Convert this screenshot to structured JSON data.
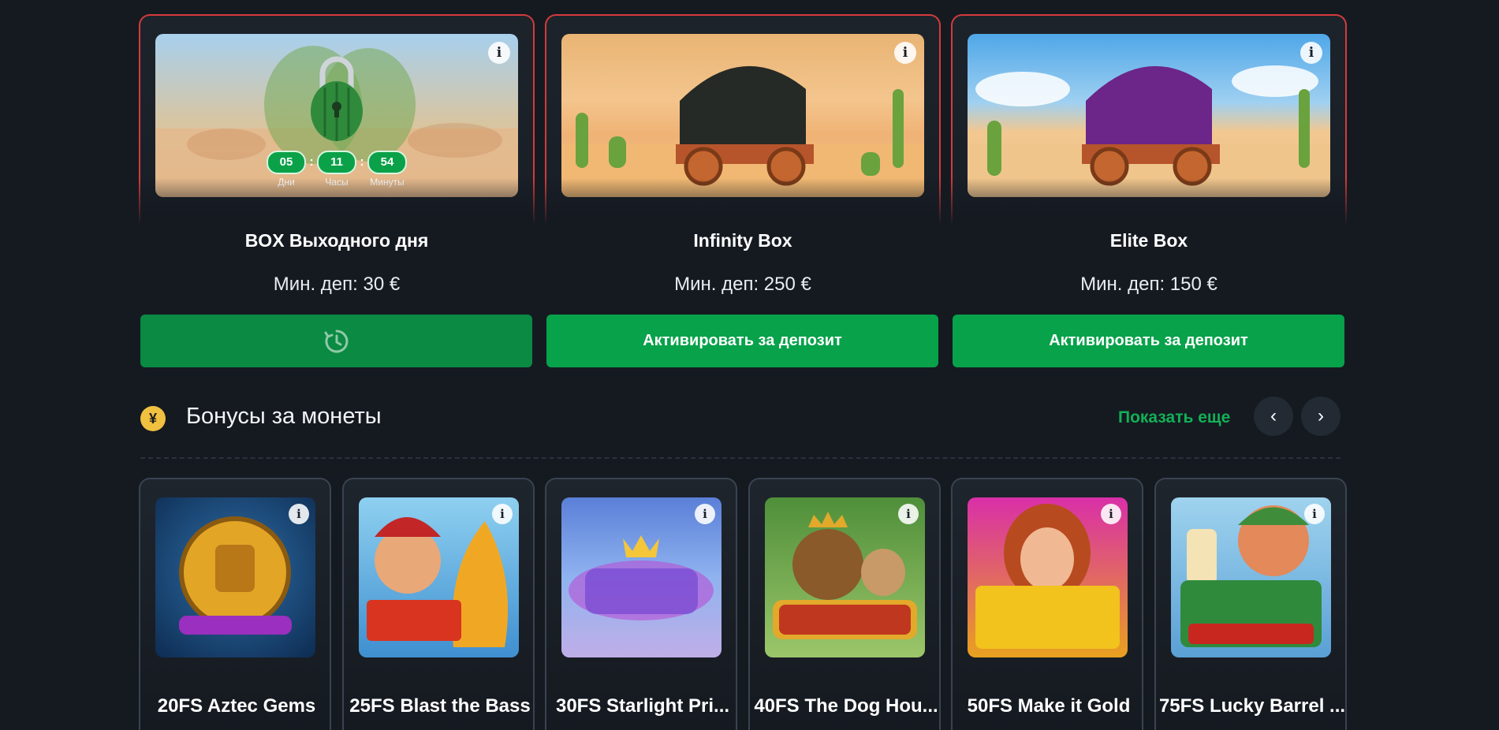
{
  "boxes": [
    {
      "title": "BOX Выходного дня",
      "min_deposit": "Мин. деп: 30 €",
      "button_label": "",
      "timer": {
        "days": "05",
        "days_label": "Дни",
        "hours": "11",
        "hours_label": "Часы",
        "minutes": "54",
        "minutes_label": "Минуты",
        "separator": ":"
      }
    },
    {
      "title": "Infinity Box",
      "min_deposit": "Мин. деп: 250 €",
      "button_label": "Активировать за депозит"
    },
    {
      "title": "Elite Box",
      "min_deposit": "Мин. деп: 150 €",
      "button_label": "Активировать за депозит"
    }
  ],
  "section": {
    "title": "Бонусы за монеты",
    "show_more": "Показать еще",
    "prev_icon": "chevron-left-icon",
    "next_icon": "chevron-right-icon"
  },
  "bonuses": [
    {
      "title": "20FS Aztec Gems"
    },
    {
      "title": "25FS Blast the Bass"
    },
    {
      "title": "30FS Starlight Pri..."
    },
    {
      "title": "40FS The Dog Hou..."
    },
    {
      "title": "50FS Make it Gold"
    },
    {
      "title": "75FS Lucky Barrel ..."
    }
  ],
  "colors": {
    "background": "#151a21",
    "accent_green": "#07a24a",
    "box_border": "#d43b3b",
    "card_border": "#3a4350",
    "link_green": "#12b056",
    "coin_yellow": "#f0c040"
  }
}
